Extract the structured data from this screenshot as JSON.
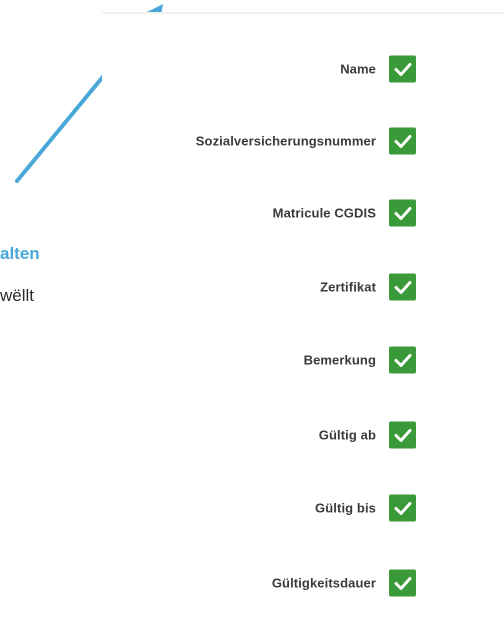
{
  "callout": {
    "title": "alten",
    "body": "wëllt"
  },
  "colors": {
    "accent": "#4aa8d8",
    "check_bg": "#3a9a3a",
    "check_mark": "#ffffff",
    "label": "#3a3a3a"
  },
  "columns": [
    {
      "label": "Name",
      "checked": true
    },
    {
      "label": "Sozialversicherungsnummer",
      "checked": true
    },
    {
      "label": "Matricule CGDIS",
      "checked": true
    },
    {
      "label": "Zertifikat",
      "checked": true
    },
    {
      "label": "Bemerkung",
      "checked": true
    },
    {
      "label": "Gültig ab",
      "checked": true
    },
    {
      "label": "Gültig bis",
      "checked": true
    },
    {
      "label": "Gültigkeitsdauer",
      "checked": true
    }
  ]
}
